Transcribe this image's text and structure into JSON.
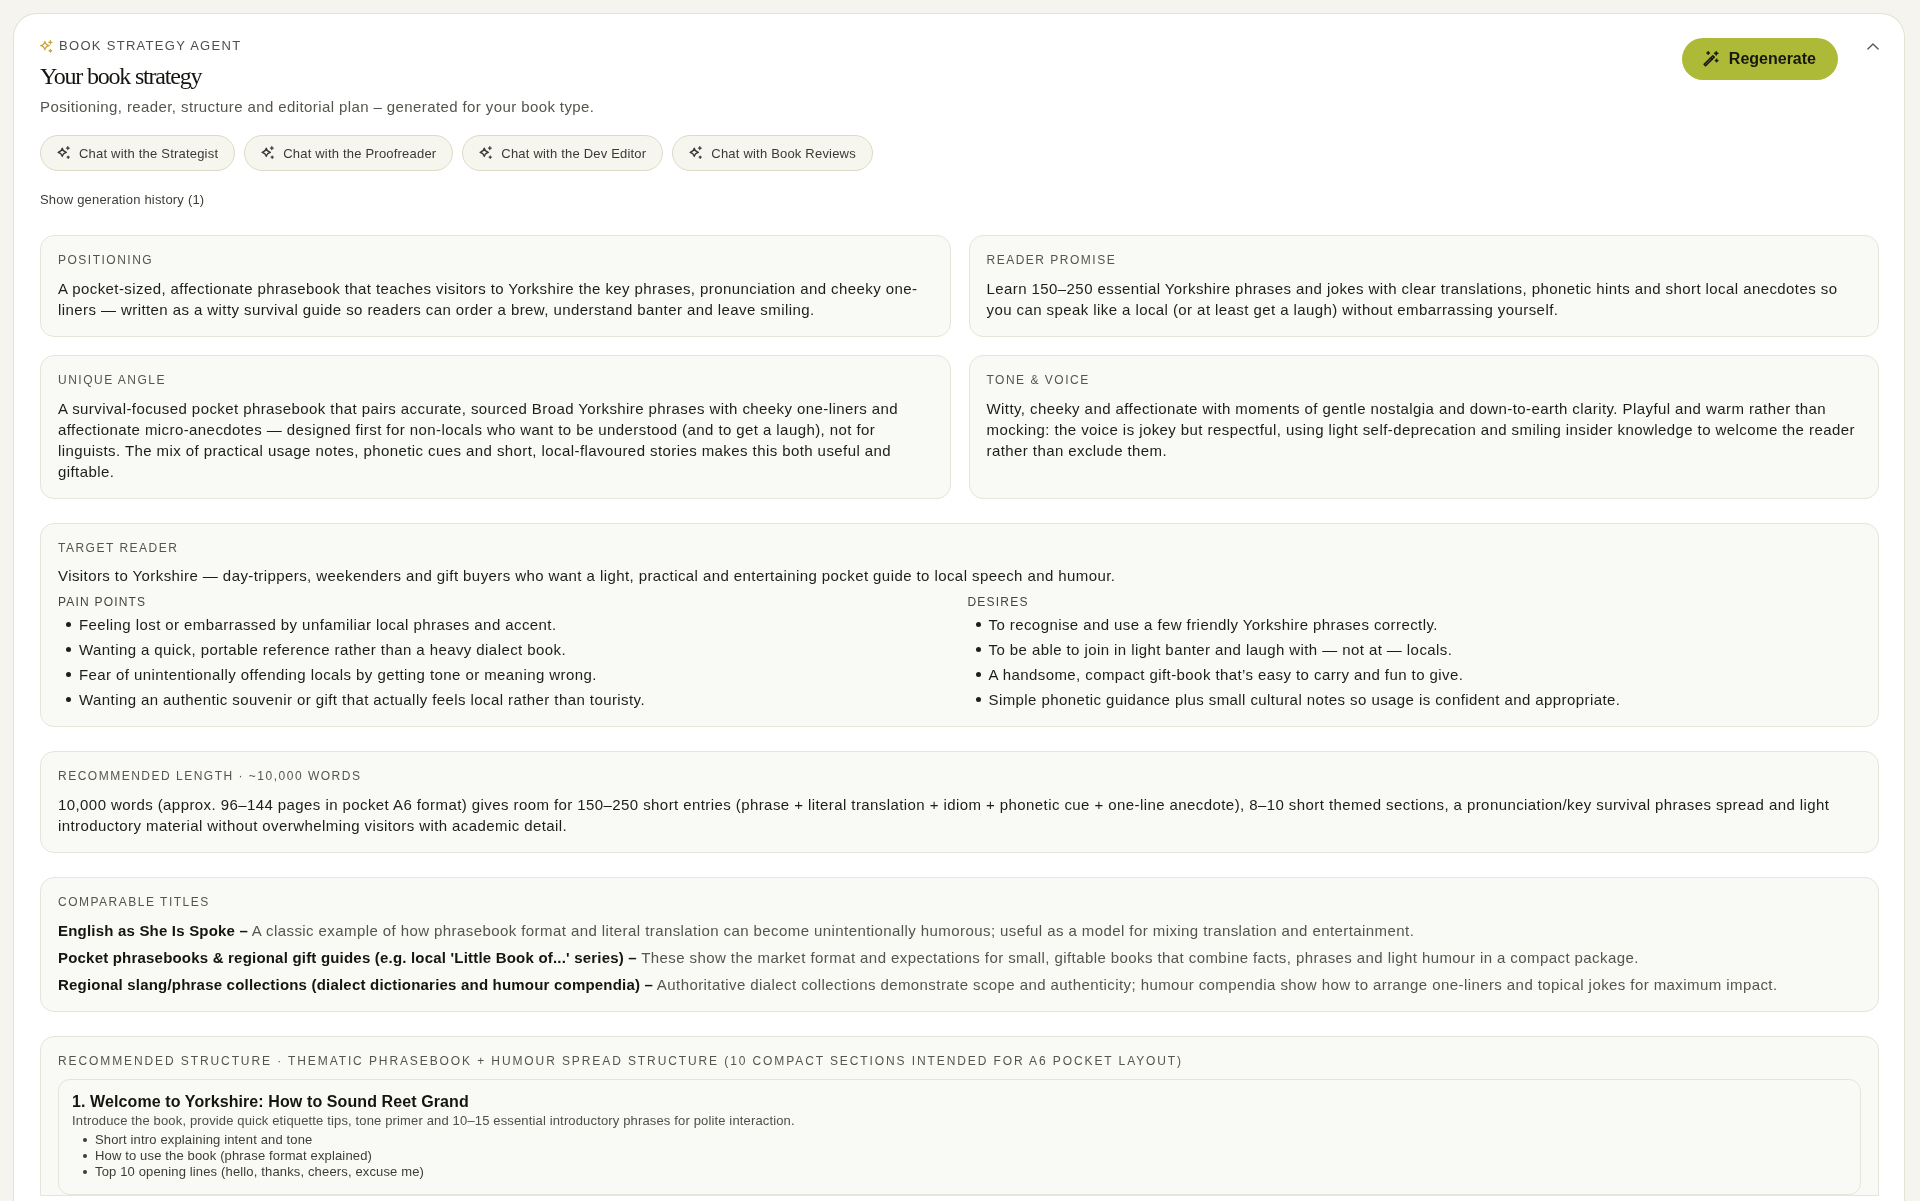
{
  "header": {
    "eyebrow": "BOOK STRATEGY AGENT",
    "title": "Your book strategy",
    "subtitle": "Positioning, reader, structure and editorial plan – generated for your book type.",
    "regenerate_button": "Regenerate",
    "expanded": true
  },
  "chat_buttons": [
    "Chat with the Strategist",
    "Chat with the Proofreader",
    "Chat with the Dev Editor",
    "Chat with Book Reviews"
  ],
  "history_toggle": "Show generation history (1)",
  "cards": [
    {
      "label": "POSITIONING",
      "text": "A pocket-sized, affectionate phrasebook that teaches visitors to Yorkshire the key phrases, pronunciation and cheeky one-liners — written as a witty survival guide so readers can order a brew, understand banter and leave smiling."
    },
    {
      "label": "READER PROMISE",
      "text": "Learn 150–250 essential Yorkshire phrases and jokes with clear translations, phonetic hints and short local anecdotes so you can speak like a local (or at least get a laugh) without embarrassing yourself."
    },
    {
      "label": "UNIQUE ANGLE",
      "text": "A survival-focused pocket phrasebook that pairs accurate, sourced Broad Yorkshire phrases with cheeky one-liners and affectionate micro-anecdotes — designed first for non-locals who want to be understood (and to get a laugh), not for linguists. The mix of practical usage notes, phonetic cues and short, local-flavoured stories makes this both useful and giftable."
    },
    {
      "label": "TONE & VOICE",
      "text": "Witty, cheeky and affectionate with moments of gentle nostalgia and down-to-earth clarity. Playful and warm rather than mocking: the voice is jokey but respectful, using light self-deprecation and smiling insider knowledge to welcome the reader rather than exclude them."
    }
  ],
  "target_reader": {
    "label": "TARGET READER",
    "summary": "Visitors to Yorkshire — day-trippers, weekenders and gift buyers who want a light, practical and entertaining pocket guide to local speech and humour.",
    "columns": [
      {
        "label": "PAIN POINTS",
        "items": [
          "Feeling lost or embarrassed by unfamiliar local phrases and accent.",
          "Wanting a quick, portable reference rather than a heavy dialect book.",
          "Fear of unintentionally offending locals by getting tone or meaning wrong.",
          "Wanting an authentic souvenir or gift that actually feels local rather than touristy."
        ]
      },
      {
        "label": "DESIRES",
        "items": [
          "To recognise and use a few friendly Yorkshire phrases correctly.",
          "To be able to join in light banter and laugh with — not at — locals.",
          "A handsome, compact gift-book that’s easy to carry and fun to give.",
          "Simple phonetic guidance plus small cultural notes so usage is confident and appropriate."
        ]
      }
    ]
  },
  "recommended_length": {
    "label": "RECOMMENDED LENGTH · ~10,000 WORDS",
    "text": "10,000 words (approx. 96–144 pages in pocket A6 format) gives room for 150–250 short entries (phrase + literal translation + idiom + phonetic cue + one-line anecdote), 8–10 short themed sections, a pronunciation/key survival phrases spread and light introductory material without overwhelming visitors with academic detail."
  },
  "comparable_titles": {
    "label": "COMPARABLE TITLES",
    "items": [
      "**English as She Is Spoke –** A classic example of how phrasebook format and literal translation can become unintentionally humorous; useful as a model for mixing translation and entertainment.",
      "**Pocket phrasebooks & regional gift guides (e.g. local 'Little Book of...' series) –** These show the market format and expectations for small, giftable books that combine facts, phrases and light humour in a compact package.",
      "**Regional slang/phrase collections (dialect dictionaries and humour compendia) –** Authoritative dialect collections demonstrate scope and authenticity; humour compendia show how to arrange one-liners and topical jokes for maximum impact."
    ]
  },
  "recommended_structure": {
    "label": "RECOMMENDED STRUCTURE · THEMATIC PHRASEBOOK + HUMOUR SPREAD STRUCTURE (10 COMPACT SECTIONS INTENDED FOR A6 POCKET LAYOUT)",
    "sections": [
      {
        "title": "1. Welcome to Yorkshire: How to Sound Reet Grand",
        "description": "Introduce the book, provide quick etiquette tips, tone primer and 10–15 essential introductory phrases for polite interaction.",
        "bullets": [
          "Short intro explaining intent and tone",
          "How to use the book (phrase format explained)",
          "Top 10 opening lines (hello, thanks, cheers, excuse me)"
        ]
      }
    ]
  }
}
